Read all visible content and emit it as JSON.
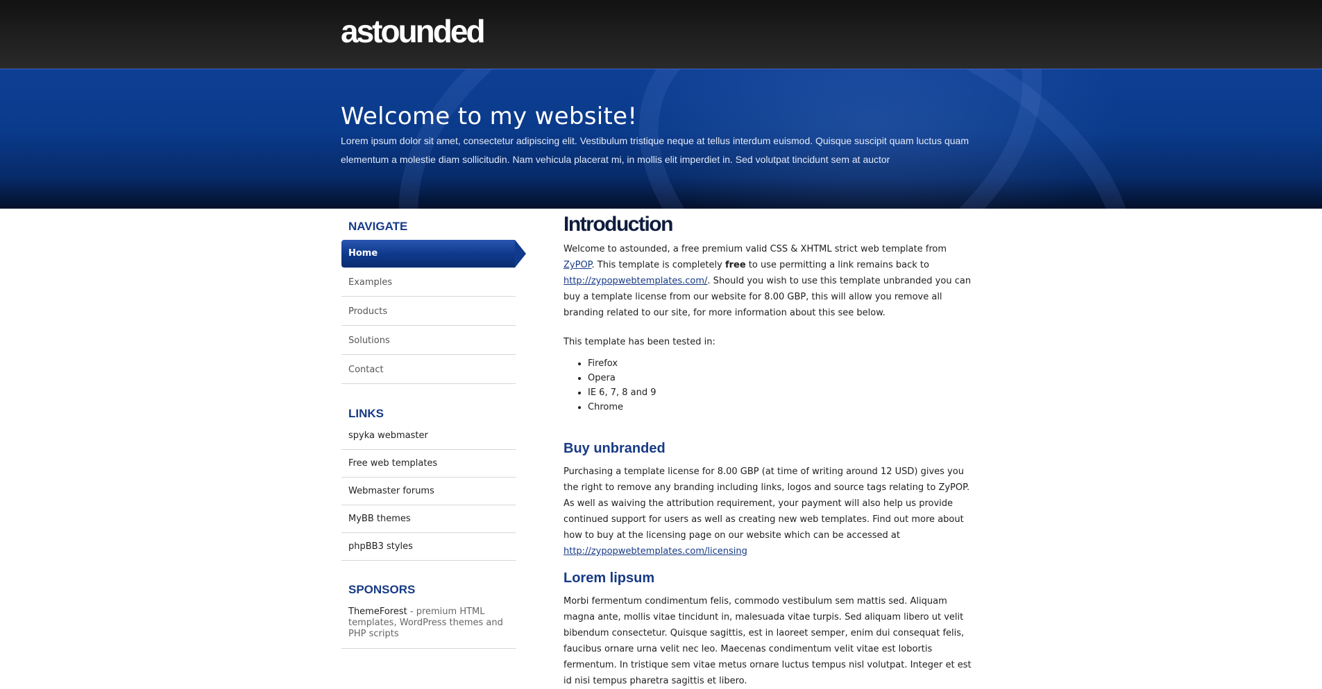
{
  "header": {
    "logo": "astounded"
  },
  "hero": {
    "title": "Welcome to my website!",
    "text": "Lorem ipsum dolor sit amet, consectetur adipiscing elit. Vestibulum tristique neque at tellus interdum euismod. Quisque suscipit quam luctus quam elementum a molestie diam sollicitudin. Nam vehicula placerat mi, in mollis elit imperdiet in. Sed volutpat tincidunt sem at auctor"
  },
  "sidebar": {
    "navigate_title": "NAVIGATE",
    "nav": [
      "Home",
      "Examples",
      "Products",
      "Solutions",
      "Contact"
    ],
    "links_title": "LINKS",
    "links": [
      "spyka webmaster",
      "Free web templates",
      "Webmaster forums",
      "MyBB themes",
      "phpBB3 styles"
    ],
    "sponsors_title": "SPONSORS",
    "sponsors": [
      {
        "name": "ThemeForest",
        "desc": " - premium HTML templates, WordPress themes and PHP scripts"
      }
    ]
  },
  "main": {
    "intro_title": "Introduction",
    "intro": {
      "t1": "Welcome to astounded, a free premium valid CSS & XHTML strict web template from ",
      "link1": "ZyPOP",
      "t2": ". This template is completely ",
      "bold": "free",
      "t3": " to use permitting a link remains back to ",
      "link2": "http://zypopwebtemplates.com/",
      "t4": ". Should you wish to use this template unbranded you can buy a template license from our website for 8.00 GBP, this will allow you remove all branding related to our site, for more information about this see below."
    },
    "tested_intro": "This template has been tested in:",
    "browsers": [
      "Firefox",
      "Opera",
      "IE 6, 7, 8 and 9",
      "Chrome"
    ],
    "buy_title": "Buy unbranded",
    "buy": {
      "text": "Purchasing a template license for 8.00 GBP (at time of writing around 12 USD) gives you the right to remove any branding including links, logos and source tags relating to ZyPOP. As well as waiving the attribution requirement, your payment will also help us provide continued support for users as well as creating new web templates. Find out more about how to buy at the licensing page on our website which can be accessed at ",
      "link": "http://zypopwebtemplates.com/licensing"
    },
    "lorem_title": "Lorem lipsum",
    "lorem_text": "Morbi fermentum condimentum felis, commodo vestibulum sem mattis sed. Aliquam magna ante, mollis vitae tincidunt in, malesuada vitae turpis. Sed aliquam libero ut velit bibendum consectetur. Quisque sagittis, est in laoreet semper, enim dui consequat felis, faucibus ornare urna velit nec leo. Maecenas condimentum velit vitae est lobortis fermentum. In tristique sem vitae metus ornare luctus tempus nisl volutpat. Integer et est id nisi tempus pharetra sagittis et libero."
  }
}
